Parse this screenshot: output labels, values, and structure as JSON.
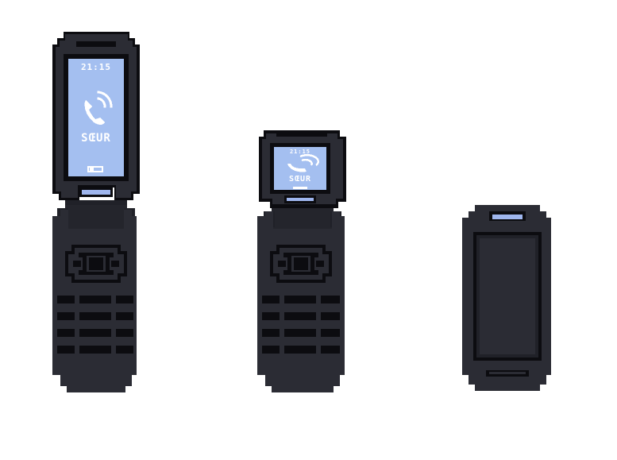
{
  "colors": {
    "body": "#2b2c34",
    "body_dark": "#202128",
    "outline": "#0c0c10",
    "hinge": "#24252c",
    "screen": "#a4bff0",
    "screen_edge": "#7f9ad8",
    "indicator": "#9fb6ee",
    "lcd_text": "#ffffff",
    "background": "#ffffff"
  },
  "sprites": [
    {
      "name": "phone-open",
      "screen": {
        "time": "21:15",
        "brand": "SŒUR",
        "icon": "phone-call-icon",
        "battery": "battery-icon"
      }
    },
    {
      "name": "phone-half-open",
      "screen": {
        "time": "21:15",
        "brand": "SŒUR",
        "icon": "phone-call-icon"
      }
    },
    {
      "name": "phone-closed"
    }
  ]
}
